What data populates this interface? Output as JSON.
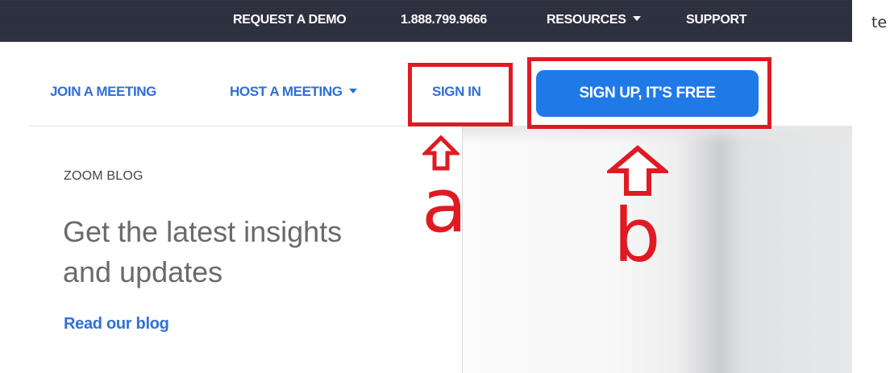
{
  "topbar": {
    "request_demo": "REQUEST A DEMO",
    "phone": "1.888.799.9666",
    "resources": "RESOURCES",
    "support": "SUPPORT"
  },
  "stray_text": "te",
  "nav": {
    "join": "JOIN A MEETING",
    "host": "HOST A MEETING",
    "sign_in": "SIGN IN",
    "sign_up": "SIGN UP, IT'S FREE"
  },
  "blog": {
    "label": "ZOOM BLOG",
    "heading_line1": "Get the latest insights",
    "heading_line2": "and updates",
    "link": "Read our blog"
  },
  "annotations": {
    "a": "a",
    "b": "b"
  },
  "colors": {
    "topbar_bg": "#2c2f3d",
    "link_blue": "#2f6fd8",
    "button_blue": "#1f7ae8",
    "annotation_red": "#e01a22"
  },
  "icons": {
    "dropdown": "chevron-down-icon",
    "annotation_arrow": "arrow-up-outline-icon"
  }
}
